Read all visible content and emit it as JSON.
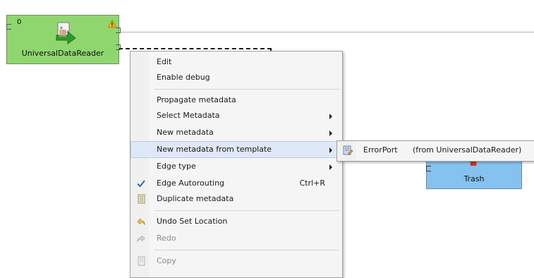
{
  "graph": {
    "reader": {
      "port_number": "0",
      "label": "UniversalDataReader",
      "colors": {
        "fill": "#8fd66f"
      }
    },
    "trash": {
      "label": "Trash",
      "colors": {
        "fill": "#86c2ef"
      }
    }
  },
  "context_menu": {
    "items": [
      {
        "label": "Edit"
      },
      {
        "label": "Enable debug"
      },
      {
        "label": "Propagate metadata"
      },
      {
        "label": "Select Metadata",
        "submenu": true
      },
      {
        "label": "New metadata",
        "submenu": true
      },
      {
        "label": "New metadata from template",
        "submenu": true,
        "highlighted": true
      },
      {
        "label": "Edge type",
        "submenu": true
      },
      {
        "label": "Edge Autorouting",
        "checked": true,
        "accelerator": "Ctrl+R",
        "icon": "check-icon"
      },
      {
        "label": "Duplicate metadata",
        "icon": "duplicate-icon"
      },
      {
        "label": "Undo Set Location",
        "icon": "undo-icon"
      },
      {
        "label": "Redo",
        "disabled": true,
        "icon": "redo-icon"
      },
      {
        "label": "Copy",
        "disabled": true,
        "icon": "copy-icon"
      }
    ],
    "colors": {
      "highlight": "#dfe8f6",
      "disabled_text": "#8a8a8a"
    }
  },
  "submenu": {
    "items": [
      {
        "name": "ErrorPort",
        "source": "(from UniversalDataReader)",
        "icon": "metadata-icon"
      }
    ]
  }
}
